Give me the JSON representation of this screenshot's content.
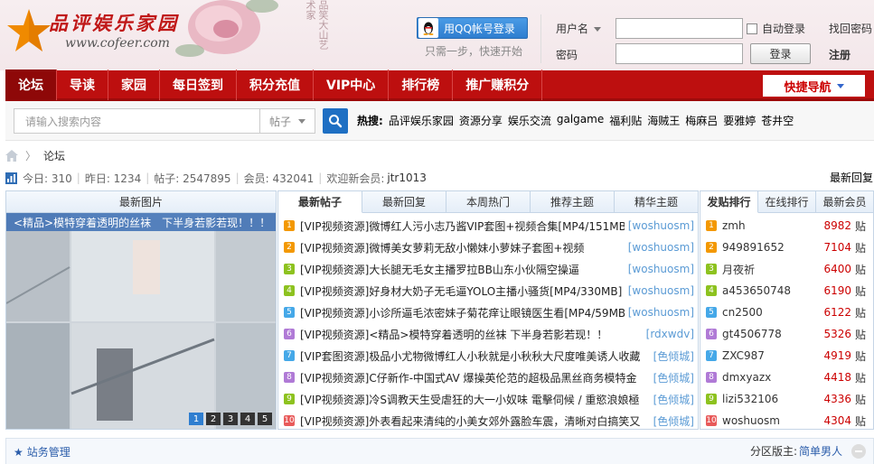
{
  "header": {
    "logo_title": "品评娱乐家园",
    "logo_url": "www.cofeer.com",
    "calligraphy": "品笑大山艺术家",
    "qq_login_label": "用QQ帐号登录",
    "qq_tip": "只需一步，快速开始",
    "username_label": "用户名",
    "password_label": "密码",
    "auto_login_label": "自动登录",
    "find_password": "找回密码",
    "login_button": "登录",
    "register": "注册"
  },
  "nav": {
    "items": [
      "论坛",
      "导读",
      "家园",
      "每日签到",
      "积分充值",
      "VIP中心",
      "排行榜",
      "推广赚积分"
    ],
    "quick_nav": "快捷导航"
  },
  "search": {
    "placeholder": "请输入搜索内容",
    "type": "帖子",
    "hot_label": "热搜:",
    "hot_words": [
      "品评娱乐家园",
      "资源分享",
      "娱乐交流",
      "galgame",
      "福利贴",
      "海贼王",
      "梅麻吕",
      "要雅婷",
      "苍井空"
    ]
  },
  "breadcrumb": {
    "current": "论坛"
  },
  "stats": {
    "today": "今日: 310",
    "yesterday": "昨日: 1234",
    "posts": "帖子: 2547895",
    "members": "会员: 432041",
    "welcome_label": "欢迎新会员:",
    "new_member": "jtr1013",
    "latest_reply": "最新回复"
  },
  "pic_panel": {
    "title": "最新图片",
    "caption": "<精品>模特穿着透明的丝袜　下半身若影若现！！！",
    "pages": [
      "1",
      "2",
      "3",
      "4",
      "5"
    ]
  },
  "thread_panel": {
    "tabs": [
      "最新帖子",
      "最新回复",
      "本周热门",
      "推荐主题",
      "精华主题"
    ],
    "threads": [
      {
        "num": "1",
        "title": "[VIP视频资源]微博红人污小志乃酱VIP套图+视频合集[MP4/151MB]",
        "author": "[woshuosm]"
      },
      {
        "num": "2",
        "title": "[VIP视频资源]微博美女萝莉无敌小懒妹小萝妹子套图+视频",
        "author": "[woshuosm]"
      },
      {
        "num": "3",
        "title": "[VIP视频资源]大长腿无毛女主播罗拉BB山东小伙隔空操逼",
        "author": "[woshuosm]"
      },
      {
        "num": "4",
        "title": "[VIP视频资源]好身材大奶子无毛逼YOLO主播小骚货[MP4/330MB]",
        "author": "[woshuosm]"
      },
      {
        "num": "5",
        "title": "[VIP视频资源]小诊所逼毛浓密妹子菊花痒让眼镜医生看[MP4/59MB]",
        "author": "[woshuosm]"
      },
      {
        "num": "6",
        "title": "[VIP视频资源]<精品>模特穿着透明的丝袜 下半身若影若现！！",
        "author": "[rdxwdv]"
      },
      {
        "num": "7",
        "title": "[VIP套图资源]极品小尤物微博红人小秋就是小秋秋大尺度唯美诱人收藏",
        "author": "[色倾城]"
      },
      {
        "num": "8",
        "title": "[VIP视频资源]C仔新作-中国式AV 爆操英伦范的超极品黑丝商务模特金",
        "author": "[色倾城]"
      },
      {
        "num": "9",
        "title": "[VIP视频资源]冷S调教天生受虐狂的大一小奴味 電擊伺候 / 重慾浪娘極",
        "author": "[色倾城]"
      },
      {
        "num": "10",
        "title": "[VIP视频资源]外表看起来清纯的小美女郊外露脸车震，清晰对白搞笑又",
        "author": "[色倾城]"
      }
    ]
  },
  "rank_panel": {
    "tabs": [
      "发贴排行",
      "在线排行",
      "最新会员"
    ],
    "suffix": "贴",
    "rows": [
      {
        "num": "1",
        "name": "zmh",
        "count": "8982"
      },
      {
        "num": "2",
        "name": "949891652",
        "count": "7104"
      },
      {
        "num": "3",
        "name": "月夜祈",
        "count": "6400"
      },
      {
        "num": "4",
        "name": "a453650748",
        "count": "6190"
      },
      {
        "num": "5",
        "name": "cn2500",
        "count": "6122"
      },
      {
        "num": "6",
        "name": "gt4506778",
        "count": "5326"
      },
      {
        "num": "7",
        "name": "ZXC987",
        "count": "4919"
      },
      {
        "num": "8",
        "name": "dmxyazx",
        "count": "4418"
      },
      {
        "num": "9",
        "name": "lizi532106",
        "count": "4336"
      },
      {
        "num": "10",
        "name": "woshuosm",
        "count": "4304"
      }
    ]
  },
  "footer": {
    "site_admin": "站务管理",
    "moderator_label": "分区版主:",
    "moderator": "简单男人"
  },
  "colors": {
    "nav_red": "#bd0f0f",
    "link_blue": "#2a5caa",
    "count_red": "#cc0000"
  }
}
